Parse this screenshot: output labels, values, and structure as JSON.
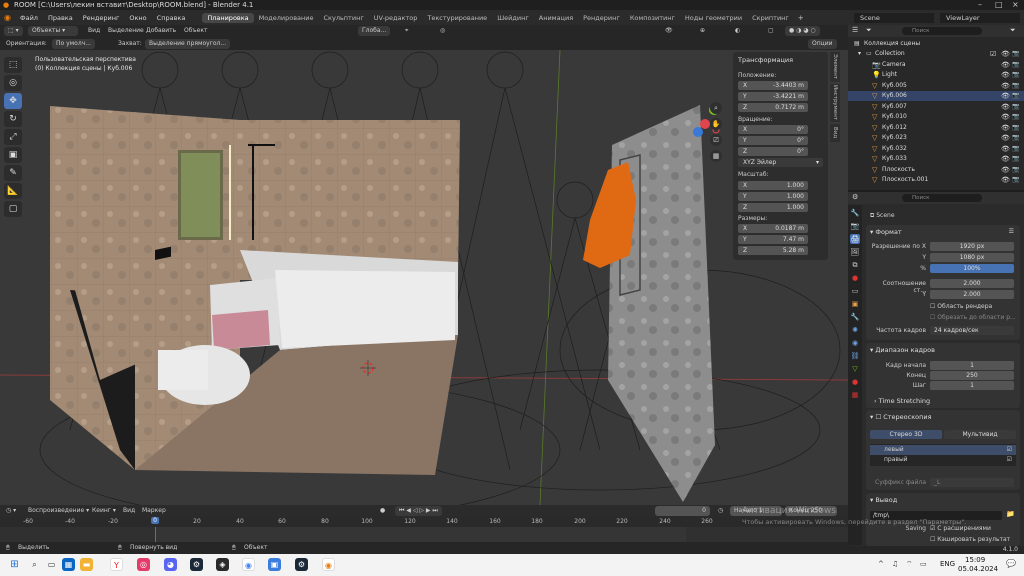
{
  "window": {
    "title": "ROOM [C:\\Users\\лекин вставит\\Desktop\\ROOM.blend] - Blender 4.1"
  },
  "menu": [
    "Файл",
    "Правка",
    "Рендеринг",
    "Окно",
    "Справка"
  ],
  "workspaces": [
    "Планировка",
    "Моделирование",
    "Скульптинг",
    "UV-редактор",
    "Текстурирование",
    "Шейдинг",
    "Анимация",
    "Рендеринг",
    "Композитинг",
    "Ноды геометрии",
    "Скриптинг"
  ],
  "scene": "Scene",
  "view_layer": "ViewLayer",
  "viewport_header": {
    "mode": "Объекты",
    "view": "Вид",
    "select": "Выделение",
    "add": "Добавить",
    "object": "Объект",
    "transform_space": "Глоба...",
    "orientation_label": "Ориентация:",
    "orientation_value": "По умолч...",
    "drag_label": "Захват:",
    "drag_value": "Выделение прямоугол...",
    "options": "Опции"
  },
  "viewport": {
    "perspective": "Пользовательская перспектива",
    "collection": "(0) Коллекция сцены | Куб.006"
  },
  "npanel": {
    "title": "Трансформация",
    "location_label": "Положение:",
    "location": [
      "-3.4403 m",
      "-3.4221 m",
      "0.7172 m"
    ],
    "rotation_label": "Вращение:",
    "rotation": [
      "0°",
      "0°",
      "0°"
    ],
    "rotation_mode": "XYZ Эйлер",
    "scale_label": "Масштаб:",
    "scale": [
      "1.000",
      "1.000",
      "1.000"
    ],
    "dimensions_label": "Размеры:",
    "dimensions": [
      "0.0187 m",
      "7.47 m",
      "5.28 m"
    ],
    "axes": [
      "X",
      "Y",
      "Z"
    ],
    "tabs": [
      "Элемент",
      "Инструмент",
      "Вид"
    ]
  },
  "outliner": {
    "search_placeholder": "Поиск",
    "root": "Коллекция сцены",
    "collection": "Collection",
    "items": [
      "Camera",
      "Light",
      "Куб.005",
      "Куб.006",
      "Куб.007",
      "Куб.010",
      "Куб.012",
      "Куб.023",
      "Куб.032",
      "Куб.033",
      "Плоскость",
      "Плоскость.001"
    ]
  },
  "properties": {
    "scene_name": "Scene",
    "format_title": "Формат",
    "res_x_label": "Разрешение по X",
    "res_x": "1920 px",
    "res_y_label": "Y",
    "res_y": "1080 px",
    "res_pct_label": "%",
    "res_pct": "100%",
    "aspect_label": "Соотношение ст...",
    "aspect_x": "2.000",
    "aspect_y_label": "Y",
    "aspect_y": "2.000",
    "render_region": "Область рендера",
    "crop_region": "Обрезать до области р...",
    "fps_label": "Частота кадров",
    "fps": "24 кадров/сек",
    "frame_range_title": "Диапазон кадров",
    "frame_start_label": "Кадр начала",
    "frame_start": "1",
    "frame_end_label": "Конец",
    "frame_end": "250",
    "frame_step_label": "Шаг",
    "frame_step": "1",
    "time_stretching": "Time Stretching",
    "stereo_title": "Стереоскопия",
    "stereo_3d": "Стерео 3D",
    "multiview": "Мультивид",
    "left": "левый",
    "right": "правый",
    "file_suffix_label": "Суффикс файла",
    "file_suffix": "_L",
    "output_title": "Вывод",
    "output_path": "/tmp\\",
    "saving_label": "Saving",
    "file_extensions": "С расширениями",
    "cache_result": "Кэшировать результат"
  },
  "timeline": {
    "playback": "Воспроизведение",
    "keying": "Кеинг",
    "view": "Вид",
    "marker": "Маркер",
    "current_frame": "0",
    "start_label": "Начало",
    "start": "1",
    "end_label": "Конец",
    "end": "250",
    "ticks": [
      "-60",
      "-40",
      "-20",
      "0",
      "20",
      "40",
      "60",
      "80",
      "100",
      "120",
      "140",
      "160",
      "180",
      "200",
      "220",
      "240",
      "260"
    ]
  },
  "activation": {
    "title": "Активация Windows",
    "subtitle": "Чтобы активировать Windows, перейдите в раздел \"Параметры\"."
  },
  "statusbar": {
    "select": "Выделить",
    "rotate": "Повернуть вид",
    "object": "Объект",
    "version": "4.1.0"
  },
  "taskbar": {
    "lang": "ENG",
    "time": "15:09",
    "date": "05.04.2024"
  },
  "colors": {
    "accent": "#4772b3",
    "active_workspace": "#474747",
    "towel": "#e06a14",
    "tile": "#a9917a",
    "floor": "#8a7565"
  }
}
